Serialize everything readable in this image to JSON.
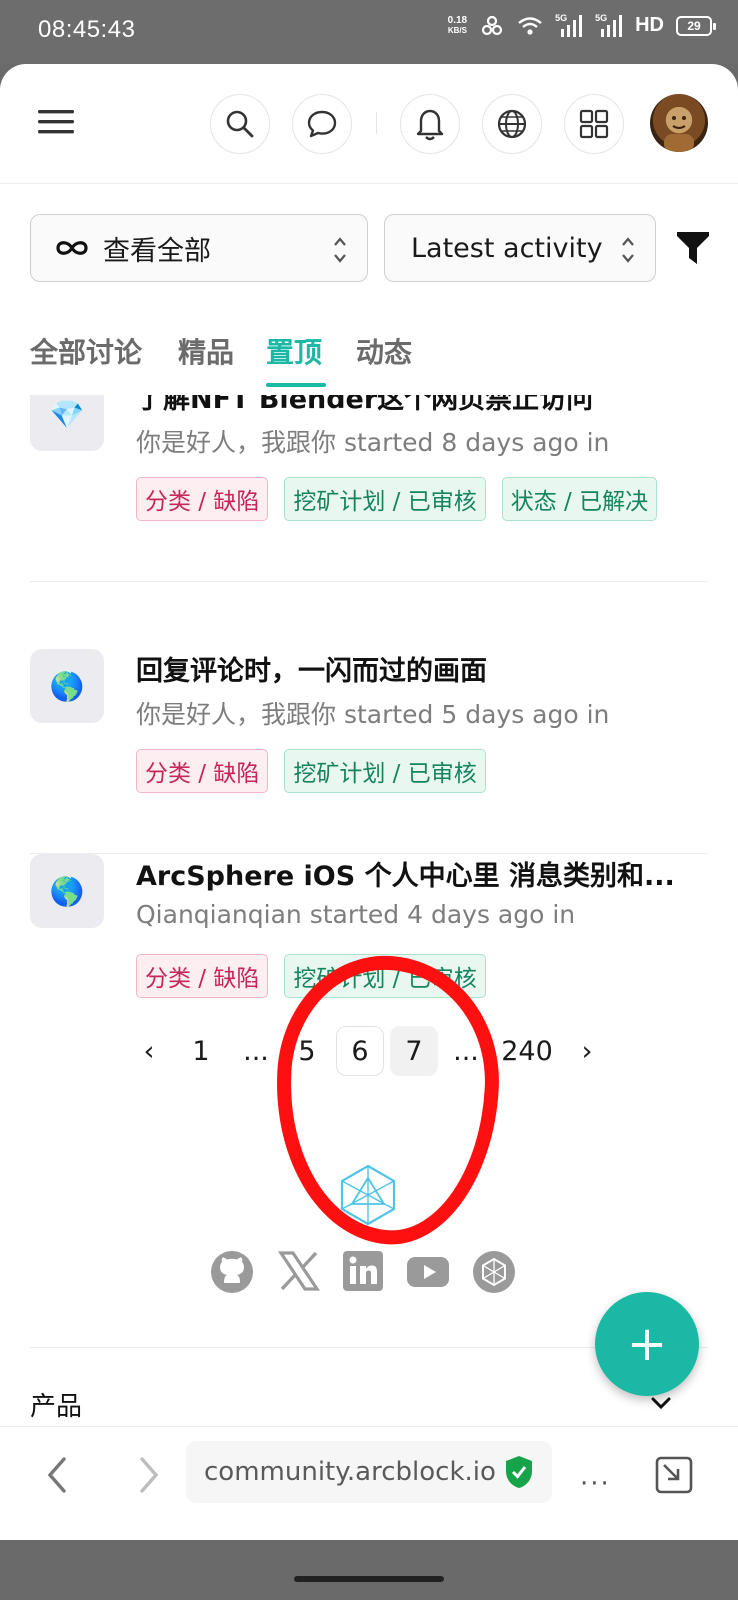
{
  "status_bar": {
    "time": "08:45:43",
    "net_speed_value": "0.18",
    "net_speed_unit": "KB/S",
    "network_label_1": "5G",
    "network_label_2": "5G",
    "hd_label": "HD",
    "battery": "29"
  },
  "header": {
    "menu_icon": "hamburger-menu-icon",
    "search_icon": "search-icon",
    "chat_icon": "chat-bubble-icon",
    "bell_icon": "bell-icon",
    "globe_icon": "globe-icon",
    "apps_icon": "apps-grid-icon"
  },
  "filters": {
    "scope_label": "查看全部",
    "sort_label": "Latest activity"
  },
  "tabs": [
    {
      "label": "全部讨论",
      "active": false
    },
    {
      "label": "精品",
      "active": false
    },
    {
      "label": "置顶",
      "active": true
    },
    {
      "label": "动态",
      "active": false
    }
  ],
  "discussions": [
    {
      "icon": "💎",
      "title": "了解NFT Blender这个网页禁止访问",
      "meta": "你是好人，我跟你 started 8 days ago in",
      "tags": [
        {
          "text": "分类 / 缺陷",
          "color": "red"
        },
        {
          "text": "挖矿计划 / 已审核",
          "color": "green"
        },
        {
          "text": "状态 / 已解决",
          "color": "green"
        }
      ]
    },
    {
      "icon": "🌎",
      "title": "回复评论时，一闪而过的画面",
      "meta": "你是好人，我跟你 started 5 days ago in",
      "tags": [
        {
          "text": "分类 / 缺陷",
          "color": "red"
        },
        {
          "text": "挖矿计划 / 已审核",
          "color": "green"
        }
      ]
    },
    {
      "icon": "🌎",
      "title": "ArcSphere iOS 个人中心里 消息类别和...",
      "meta": "Qianqianqian started 4 days ago in",
      "tags": [
        {
          "text": "分类 / 缺陷",
          "color": "red"
        },
        {
          "text": "挖矿计划 / 已审核",
          "color": "green"
        }
      ]
    }
  ],
  "pagination": {
    "prev": "‹",
    "first": "1",
    "ellipsis_left": "...",
    "p5": "5",
    "current": "6",
    "p7": "7",
    "ellipsis_right": "...",
    "last": "240",
    "next": "›"
  },
  "footer": {
    "social": [
      "github-icon",
      "x-icon",
      "linkedin-icon",
      "youtube-icon",
      "arcblock-icon"
    ],
    "section_label": "产品"
  },
  "fab": {
    "label": "+"
  },
  "browser": {
    "url": "community.arcblock.io",
    "more": "···"
  },
  "colors": {
    "accent": "#1bb8a6",
    "tag_red": "#c7265a",
    "tag_green": "#16845f",
    "annotation": "#ff1010"
  }
}
